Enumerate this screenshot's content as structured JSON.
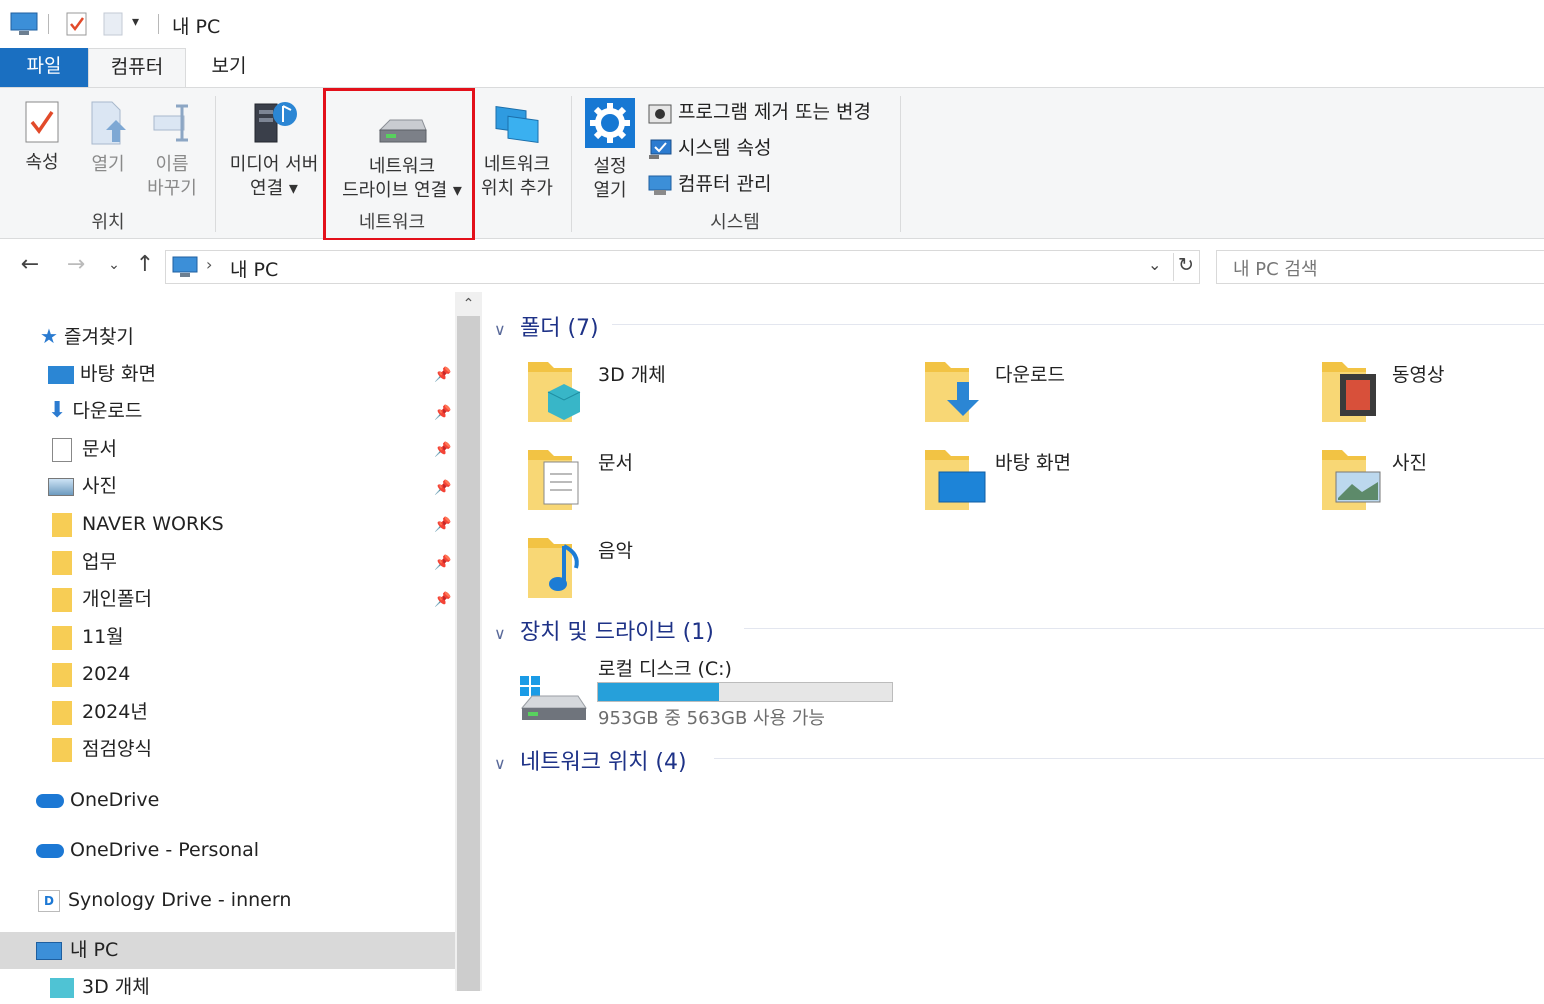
{
  "titlebar": {
    "title": "내 PC"
  },
  "tabs": {
    "file": "파일",
    "computer": "컴퓨터",
    "view": "보기"
  },
  "ribbon": {
    "location": {
      "label": "위치",
      "properties": "속성",
      "open": "열기",
      "rename_line1": "이름",
      "rename_line2": "바꾸기"
    },
    "network": {
      "label": "네트워크",
      "media_server_line1": "미디어 서버",
      "media_server_line2": "연결",
      "map_drive_line1": "네트워크",
      "map_drive_line2": "드라이브 연결",
      "add_location_line1": "네트워크",
      "add_location_line2": "위치 추가"
    },
    "system": {
      "label": "시스템",
      "settings_line1": "설정",
      "settings_line2": "열기",
      "uninstall": "프로그램 제거 또는 변경",
      "system_props": "시스템 속성",
      "manage": "컴퓨터 관리"
    }
  },
  "address": {
    "path": "내 PC",
    "search_placeholder": "내 PC 검색"
  },
  "nav": {
    "quick_access": "즐겨찾기",
    "items": [
      "바탕 화면",
      "다운로드",
      "문서",
      "사진",
      "NAVER WORKS",
      "업무",
      "개인폴더",
      "11월",
      "2024",
      "2024년",
      "점검양식"
    ],
    "onedrive": "OneDrive",
    "onedrive_personal": "OneDrive - Personal",
    "synology": "Synology Drive - innern",
    "this_pc": "내 PC",
    "objects3d": "3D 개체"
  },
  "content": {
    "folders_header": "폴더 (7)",
    "folders": [
      "3D 개체",
      "다운로드",
      "동영상",
      "문서",
      "바탕 화면",
      "사진",
      "음악"
    ],
    "devices_header": "장치 및 드라이브 (1)",
    "drive_name": "로컬 디스크 (C:)",
    "drive_free": "953GB 중 563GB 사용 가능",
    "drive_used_fraction": 0.41,
    "network_header": "네트워크 위치 (4)"
  },
  "colors": {
    "accent": "#1a6fc1",
    "highlight": "#e3101a",
    "drive_fill": "#26a0da"
  }
}
